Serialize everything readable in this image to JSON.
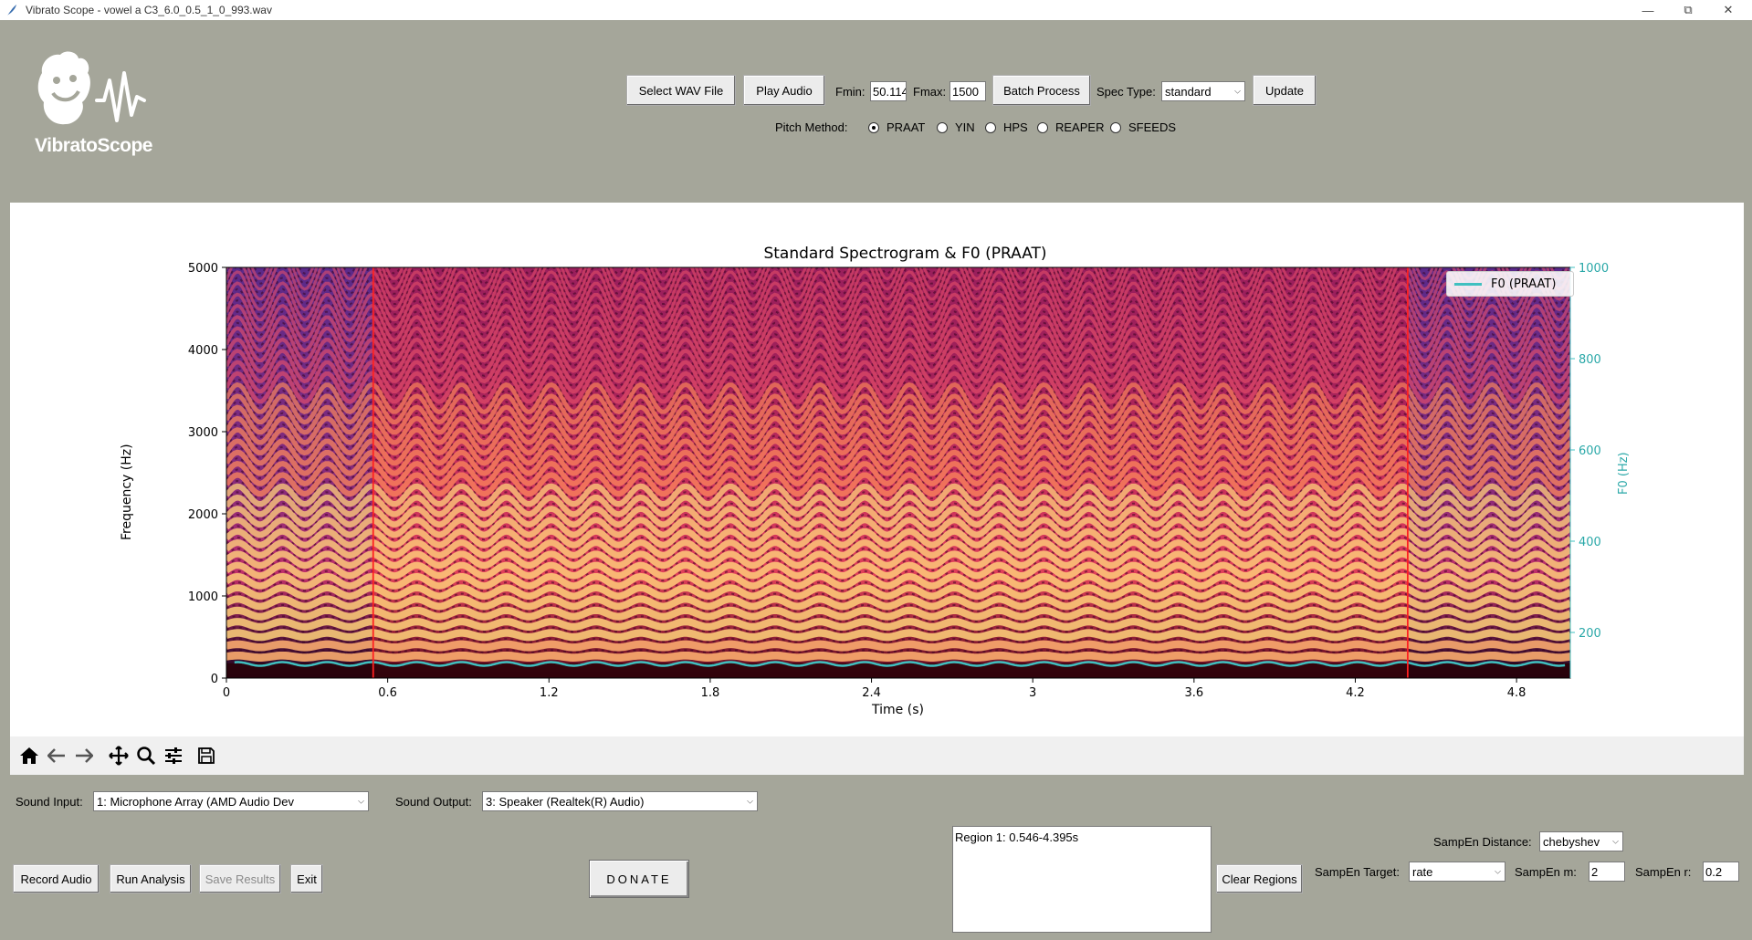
{
  "window": {
    "title": "Vibrato Scope - vowel a C3_6.0_0.5_1_0_993.wav",
    "controls": [
      "minimize-icon",
      "restore-icon",
      "close-icon"
    ]
  },
  "logo": {
    "text": "VibratoScope"
  },
  "controls": {
    "select_wav": "Select WAV File",
    "play_audio": "Play Audio",
    "fmin_label": "Fmin:",
    "fmin_value": "50.114",
    "fmax_label": "Fmax:",
    "fmax_value": "1500",
    "batch_process": "Batch Process",
    "spec_type_label": "Spec Type:",
    "spec_type_value": "standard",
    "update": "Update",
    "pitch_method_label": "Pitch Method:",
    "pitch_methods": [
      "PRAAT",
      "YIN",
      "HPS",
      "REAPER",
      "SFEEDS"
    ],
    "pitch_method_selected": "PRAAT"
  },
  "toolbar_icons": [
    "home-icon",
    "back-arrow-icon",
    "forward-arrow-icon",
    "pan-icon",
    "zoom-icon",
    "configure-subplots-icon",
    "save-icon"
  ],
  "bottom": {
    "sound_input_label": "Sound Input:",
    "sound_input_value": "1: Microphone Array (AMD Audio Dev",
    "sound_output_label": "Sound Output:",
    "sound_output_value": "3: Speaker (Realtek(R) Audio)",
    "record_audio": "Record Audio",
    "run_analysis": "Run Analysis",
    "save_results": "Save Results",
    "exit": "Exit",
    "donate": "DONATE",
    "regions_text": "Region 1: 0.546-4.395s",
    "clear_regions": "Clear Regions",
    "sampen_distance_label": "SampEn Distance:",
    "sampen_distance_value": "chebyshev",
    "sampen_target_label": "SampEn Target:",
    "sampen_target_value": "rate",
    "sampen_m_label": "SampEn m:",
    "sampen_m_value": "2",
    "sampen_r_label": "SampEn r:",
    "sampen_r_value": "0.2"
  },
  "chart_data": {
    "type": "heatmap",
    "title": "Standard Spectrogram & F0 (PRAAT)",
    "xlabel": "Time (s)",
    "ylabel": "Frequency (Hz)",
    "y2label": "F0 (Hz)",
    "xlim": [
      0,
      5.0
    ],
    "ylim": [
      0,
      5000
    ],
    "y2lim": [
      100,
      1000
    ],
    "xticks": [
      "0",
      "0.6",
      "1.2",
      "1.8",
      "2.4",
      "3",
      "3.6",
      "4.2",
      "4.8"
    ],
    "xtick_values": [
      0,
      0.6,
      1.2,
      1.8,
      2.4,
      3.0,
      3.6,
      4.2,
      4.8
    ],
    "yticks": [
      "0",
      "1000",
      "2000",
      "3000",
      "4000",
      "5000"
    ],
    "ytick_values": [
      0,
      1000,
      2000,
      3000,
      4000,
      5000
    ],
    "y2ticks": [
      "200",
      "400",
      "600",
      "800",
      "1000"
    ],
    "y2tick_values": [
      200,
      400,
      600,
      800,
      1000
    ],
    "legend": {
      "label": "F0 (PRAAT)",
      "position": "top-right"
    },
    "f0": {
      "base_hz": 131,
      "vibrato_rate_hz": 6.0,
      "vibrato_extent_hz": 4,
      "color": "#40c0c0"
    },
    "harmonic_spacing_hz": 131,
    "region": {
      "start": 0.546,
      "end": 4.395,
      "color": "#ff2020"
    },
    "colormap": "magma"
  }
}
